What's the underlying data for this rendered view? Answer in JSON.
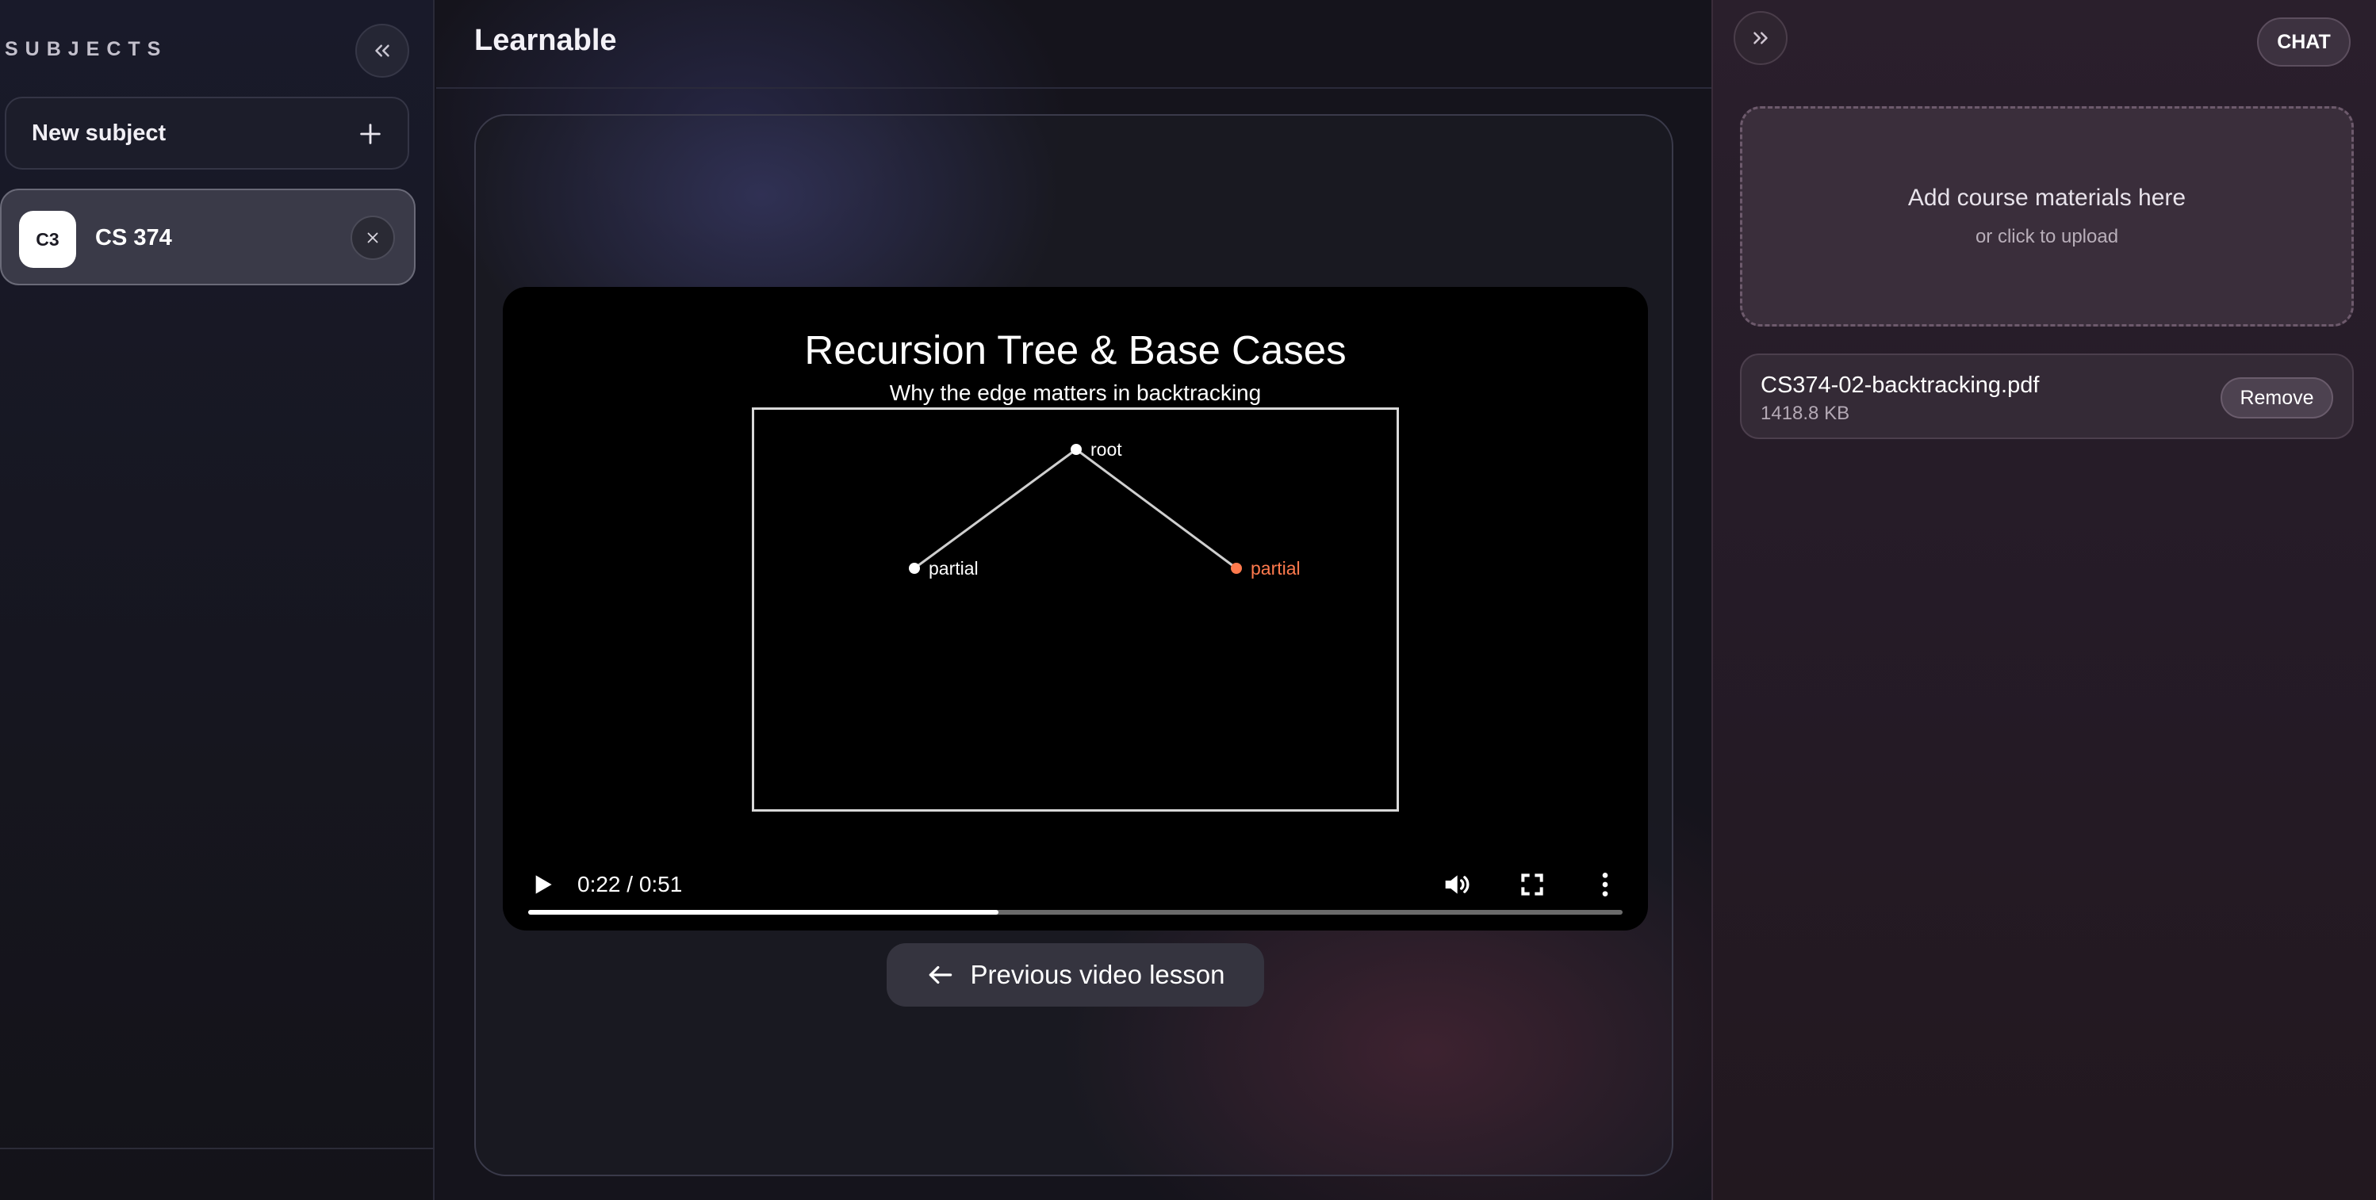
{
  "sidebar": {
    "heading": "SUBJECTS",
    "new_subject_label": "New subject",
    "subjects": [
      {
        "avatar": "C3",
        "name": "CS 374"
      }
    ]
  },
  "main": {
    "app_title": "Learnable",
    "video": {
      "slide_title": "Recursion Tree & Base Cases",
      "slide_subtitle": "Why the edge matters in backtracking",
      "tree_nodes": [
        {
          "label": "root",
          "color": "#ffffff"
        },
        {
          "label": "partial",
          "color": "#ffffff"
        },
        {
          "label": "partial",
          "color": "#ff7a4d"
        }
      ],
      "time": "0:22 / 0:51",
      "progress_fraction": 0.43
    },
    "prev_button_label": "Previous video lesson"
  },
  "right_panel": {
    "chat_label": "CHAT",
    "dropzone_title": "Add course materials here",
    "dropzone_subtitle": "or click to upload",
    "files": [
      {
        "name": "CS374-02-backtracking.pdf",
        "size": "1418.8 KB",
        "remove_label": "Remove"
      }
    ]
  },
  "icons": {
    "collapse": "chevrons-left-icon",
    "expand": "chevrons-right-icon",
    "plus": "plus-icon",
    "close": "close-icon",
    "play": "play-icon",
    "volume": "volume-icon",
    "fullscreen": "fullscreen-icon",
    "more": "more-vertical-icon",
    "arrow_left": "arrow-left-icon"
  }
}
